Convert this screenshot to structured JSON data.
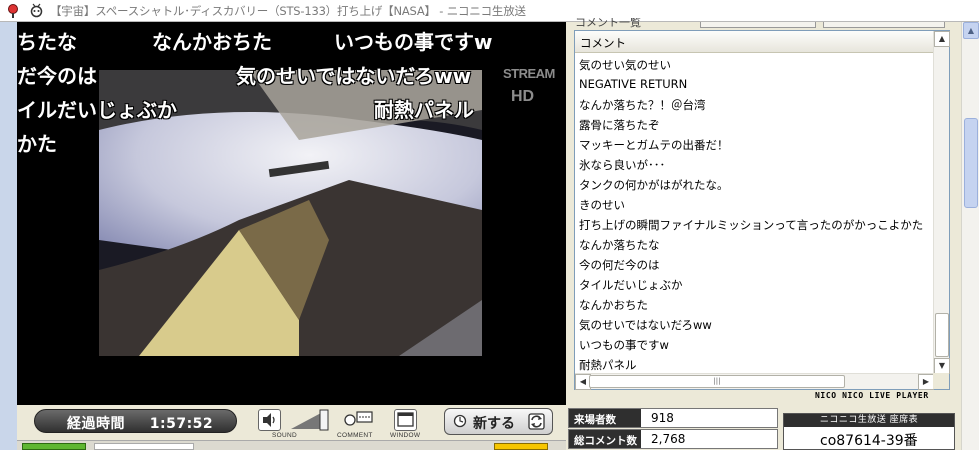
{
  "window": {
    "title": "【宇宙】スペースシャトル･ディスカバリー（STS-133）打ち上げ【NASA】 - ニコニコ生放送"
  },
  "video": {
    "watermark_line1": "STREAM",
    "watermark_line2": "HD",
    "overlay_comments": [
      "ちたな",
      "なんかおちた",
      "いつもの事ですw",
      "だ今のは",
      "気のせいではないだろww",
      "イルだいじょぶか",
      "耐熱パネル",
      "かた"
    ]
  },
  "comment_panel": {
    "label": "コメント一覧",
    "column_header": "コメント",
    "comments": [
      "気のせい気のせい",
      "NEGATIVE RETURN",
      "なんか落ちた？！＠台湾",
      "露骨に落ちたぞ",
      "マッキーとガムテの出番だ！",
      "氷なら良いが･･･",
      "タンクの何かがはがれたな。",
      "きのせい",
      "打ち上げの瞬間ファイナルミッションって言ったのがかっこよかた",
      "なんか落ちたな",
      "今の何だ今のは",
      "タイルだいじょぶか",
      "なんかおちた",
      "気のせいではないだろww",
      "いつもの事ですw",
      "耐熱パネル"
    ],
    "player_label": "NICO NICO LIVE PLAYER"
  },
  "controls": {
    "elapsed_label": "経過時間",
    "elapsed_value": "1:57:52",
    "sound_label": "SOUND",
    "comment_label": "COMMENT",
    "window_label": "WINDOW",
    "refresh_label": "新する"
  },
  "stats": {
    "visitors_label": "来場者数",
    "visitors_value": "918",
    "comments_label": "総コメント数",
    "comments_value": "2,768"
  },
  "community": {
    "header": "ニコニコ生放送 座席表",
    "seat": "co87614-39番"
  },
  "icon_names": [
    "niconico-logo-icon",
    "niconico-tv-icon",
    "speaker-icon",
    "volume-slider",
    "comment-icon",
    "window-icon",
    "refresh-icon",
    "reload-arrows-icon"
  ]
}
